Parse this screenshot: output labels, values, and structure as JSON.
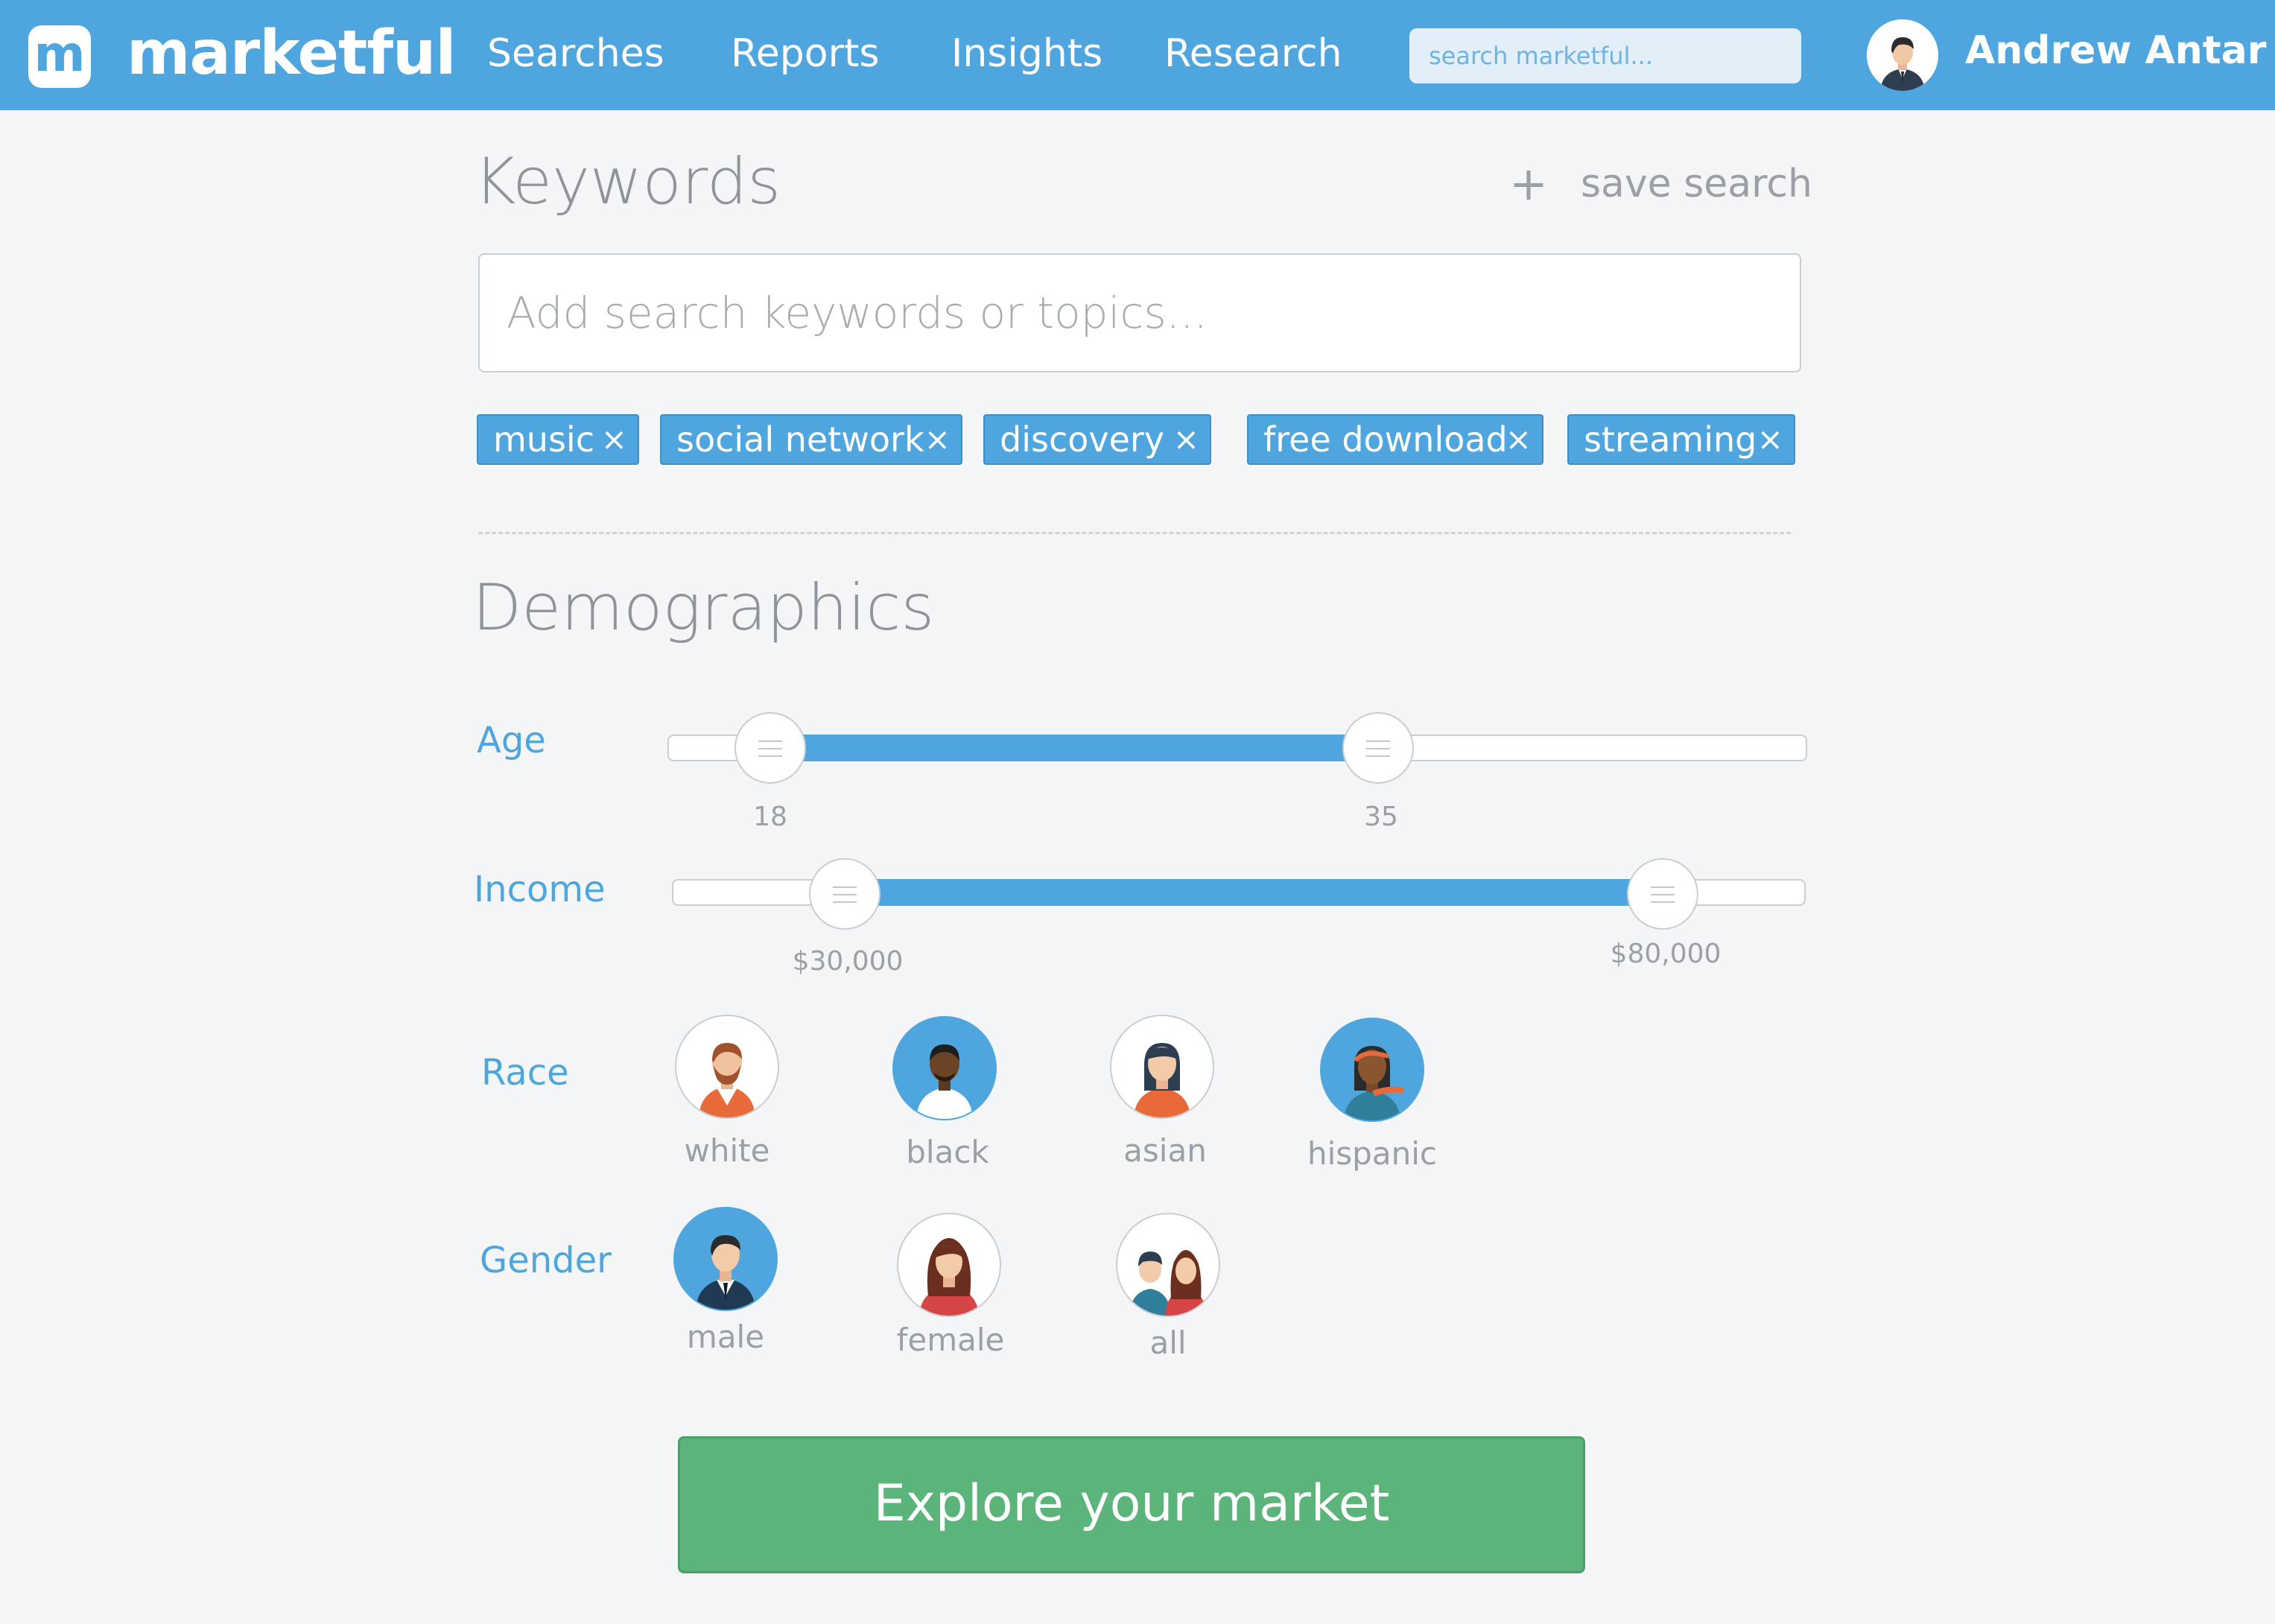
{
  "header": {
    "logo_letter": "m",
    "brand": "marketful",
    "nav": [
      "Searches",
      "Reports",
      "Insights",
      "Research"
    ],
    "search_placeholder": "search marketful...",
    "user_name": "Andrew Antar"
  },
  "keywords": {
    "title": "Keywords",
    "save_label": "save search",
    "save_icon": "plus-icon",
    "input_placeholder": "Add search keywords or topics...",
    "tags": [
      "music",
      "social network",
      "discovery",
      "free download",
      "streaming"
    ],
    "tag_remove_glyph": "×"
  },
  "demographics": {
    "title": "Demographics",
    "age": {
      "label": "Age",
      "min_label": "18",
      "max_label": "35",
      "range_fraction": [
        0.06,
        0.62
      ]
    },
    "income": {
      "label": "Income",
      "min_label": "$30,000",
      "max_label": "$80,000",
      "range_fraction": [
        0.15,
        0.88
      ]
    },
    "race": {
      "label": "Race",
      "options": [
        {
          "label": "white",
          "selected": false,
          "icon": "white-person-icon"
        },
        {
          "label": "black",
          "selected": true,
          "icon": "black-person-icon"
        },
        {
          "label": "asian",
          "selected": false,
          "icon": "asian-person-icon"
        },
        {
          "label": "hispanic",
          "selected": true,
          "icon": "hispanic-person-icon"
        }
      ]
    },
    "gender": {
      "label": "Gender",
      "options": [
        {
          "label": "male",
          "selected": true,
          "icon": "male-icon"
        },
        {
          "label": "female",
          "selected": false,
          "icon": "female-icon"
        },
        {
          "label": "all",
          "selected": false,
          "icon": "all-genders-icon"
        }
      ]
    }
  },
  "cta": {
    "label": "Explore your market"
  },
  "colors": {
    "accent": "#4fa6df",
    "cta": "#5bb47a",
    "background": "#f4f5f7"
  }
}
